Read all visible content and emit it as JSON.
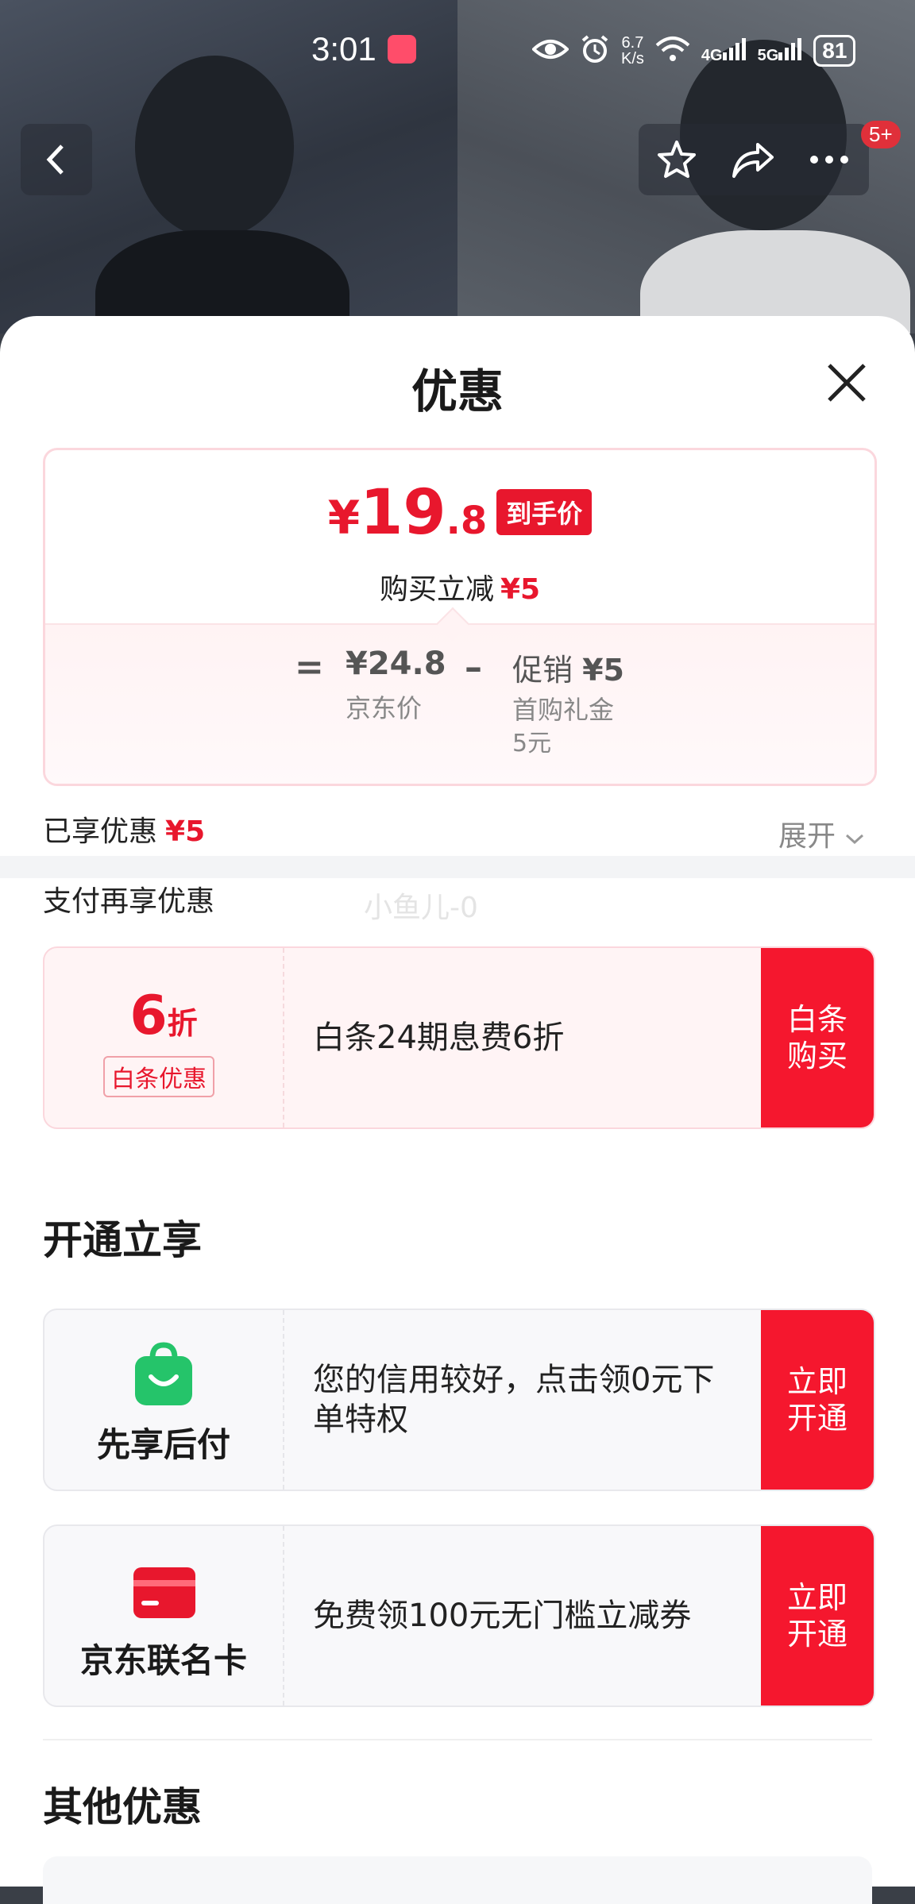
{
  "status": {
    "time": "3:01",
    "speed_top": "6.7",
    "speed_unit": "K/s",
    "net1": "4G",
    "net2": "5G",
    "battery": "81"
  },
  "nav": {
    "badge": "5+"
  },
  "sheet": {
    "title": "优惠",
    "price": {
      "yen": "¥",
      "int": "19",
      "dec": ".8",
      "tag": "到手价",
      "reduce_label": "购买立减",
      "reduce_value": "¥5"
    },
    "breakdown": {
      "eq": "=",
      "jd_price": "¥24.8",
      "jd_label": "京东价",
      "minus": "–",
      "promo_label": "促销",
      "promo_value": "¥5",
      "promo_sub": "首购礼金",
      "promo_sub2": "5元"
    },
    "enjoyed_label": "已享优惠",
    "enjoyed_value": "¥5",
    "expand": "展开",
    "pay_more": "支付再享优惠",
    "watermark": "小鱼儿-0",
    "baitiao": {
      "num": "6",
      "unit": "折",
      "tag": "白条优惠",
      "desc": "白条24期息费6折",
      "cta": "白条\n购买"
    },
    "open_section": "开通立享",
    "xianxiang": {
      "label": "先享后付",
      "desc": "您的信用较好，点击领0元下单特权",
      "cta": "立即\n开通"
    },
    "lianming": {
      "label": "京东联名卡",
      "desc": "免费领100元无门槛立减券",
      "cta": "立即\n开通"
    },
    "other_section": "其他优惠"
  },
  "colors": {
    "accent": "#e8172d",
    "cta": "#f5172e",
    "green": "#25c46a"
  }
}
